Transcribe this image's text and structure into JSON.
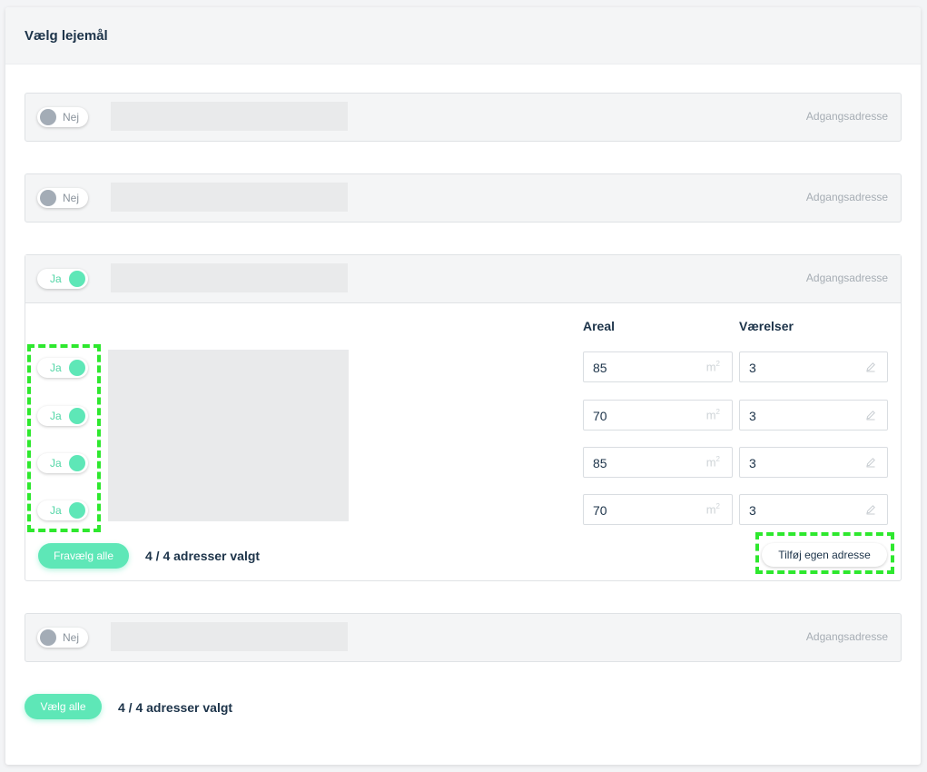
{
  "header": {
    "title": "Vælg lejemål"
  },
  "collapsed_rows": [
    {
      "toggle": "Nej",
      "address_label": "Adgangsadresse"
    },
    {
      "toggle": "Nej",
      "address_label": "Adgangsadresse"
    }
  ],
  "expanded_row": {
    "toggle": "Ja",
    "address_label": "Adgangsadresse",
    "column_headers": {
      "area": "Areal",
      "rooms": "Værelser"
    },
    "units": [
      {
        "toggle": "Ja",
        "area": "85",
        "rooms": "3"
      },
      {
        "toggle": "Ja",
        "area": "70",
        "rooms": "3"
      },
      {
        "toggle": "Ja",
        "area": "85",
        "rooms": "3"
      },
      {
        "toggle": "Ja",
        "area": "70",
        "rooms": "3"
      }
    ],
    "area_unit": "m",
    "area_unit_sup": "2",
    "deselect_all_label": "Fravælg alle",
    "selected_count": "4 / 4 adresser valgt",
    "add_own_address_label": "Tilføj egen adresse"
  },
  "last_row": {
    "toggle": "Nej",
    "address_label": "Adgangsadresse"
  },
  "footer": {
    "select_all_label": "Vælg alle",
    "selected_count": "4 / 4 adresser valgt"
  },
  "colors": {
    "accent": "#5ee7b7",
    "highlight": "#2ee82e",
    "toggle_off": "#a3acb6"
  },
  "icons": {
    "field_edit": "pencil-icon"
  }
}
